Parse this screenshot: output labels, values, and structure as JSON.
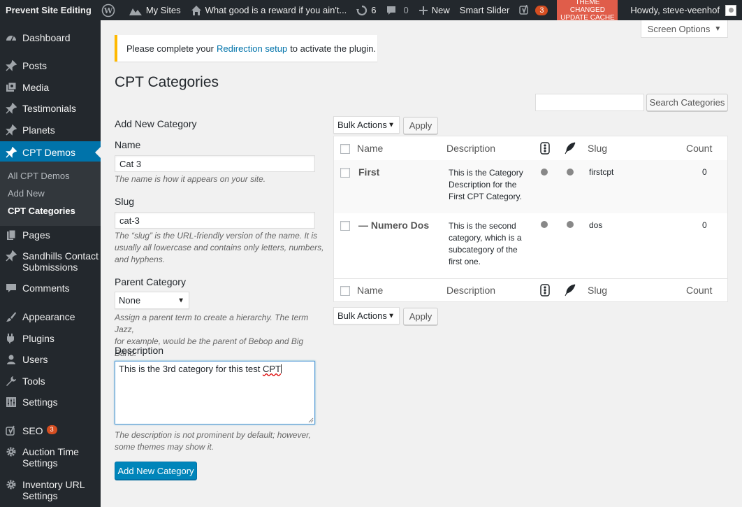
{
  "adminbar": {
    "site_name": "Prevent Site Editing",
    "my_sites": "My Sites",
    "site_title": "What good is a reward if you ain't...",
    "updates_count": "6",
    "comments_count": "0",
    "new_label": "New",
    "smart_slider": "Smart Slider",
    "yoast_count": "3",
    "theme_cache_line1": "THEME CHANGED",
    "theme_cache_line2": "UPDATE CACHE",
    "howdy": "Howdy, steve-veenhof"
  },
  "sidebar": {
    "dashboard": "Dashboard",
    "posts": "Posts",
    "media": "Media",
    "testimonials": "Testimonials",
    "planets": "Planets",
    "cpt_demos": "CPT Demos",
    "submenu": {
      "all": "All CPT Demos",
      "add_new": "Add New",
      "categories": "CPT Categories"
    },
    "pages": "Pages",
    "sandhills_1": "Sandhills Contact",
    "sandhills_2": "Submissions",
    "comments": "Comments",
    "appearance": "Appearance",
    "plugins": "Plugins",
    "users": "Users",
    "tools": "Tools",
    "settings": "Settings",
    "seo": "SEO",
    "seo_count": "3",
    "auction_1": "Auction Time",
    "auction_2": "Settings",
    "inventory_1": "Inventory URL",
    "inventory_2": "Settings"
  },
  "screen_options": "Screen Options",
  "notice": {
    "before": "Please complete your",
    "link": "Redirection setup",
    "after": "to activate the plugin."
  },
  "page_title": "CPT Categories",
  "search": {
    "value": "",
    "button": "Search Categories"
  },
  "form": {
    "heading": "Add New Category",
    "name_label": "Name",
    "name_value": "Cat 3",
    "name_desc": "The name is how it appears on your site.",
    "slug_label": "Slug",
    "slug_value": "cat-3",
    "slug_desc_1": "The “slug” is the URL-friendly version of the name. It is",
    "slug_desc_2": "usually all lowercase and contains only letters, numbers,",
    "slug_desc_3": "and hyphens.",
    "parent_label": "Parent Category",
    "parent_value": "None",
    "parent_desc_1": "Assign a parent term to create a hierarchy. The term Jazz,",
    "parent_desc_2": "for example, would be the parent of Bebop and Big Band.",
    "description_label": "Description",
    "description_text": "This is the 3rd category for this test",
    "description_spell": "CPT",
    "description_desc_1": "The description is not prominent by default; however,",
    "description_desc_2": "some themes may show it.",
    "submit": "Add New Category"
  },
  "bulk": {
    "label": "Bulk Actions",
    "apply": "Apply"
  },
  "table": {
    "headers": {
      "name": "Name",
      "description": "Description",
      "slug": "Slug",
      "count": "Count"
    },
    "rows": [
      {
        "name": "First",
        "desc": [
          "This is the Category",
          "Description for the",
          "First CPT Category."
        ],
        "slug": "firstcpt",
        "count": "0"
      },
      {
        "name": "— Numero Dos",
        "desc": [
          "This is the second",
          "category, which is a",
          "subcategory of the",
          "first one."
        ],
        "slug": "dos",
        "count": "0"
      }
    ]
  }
}
